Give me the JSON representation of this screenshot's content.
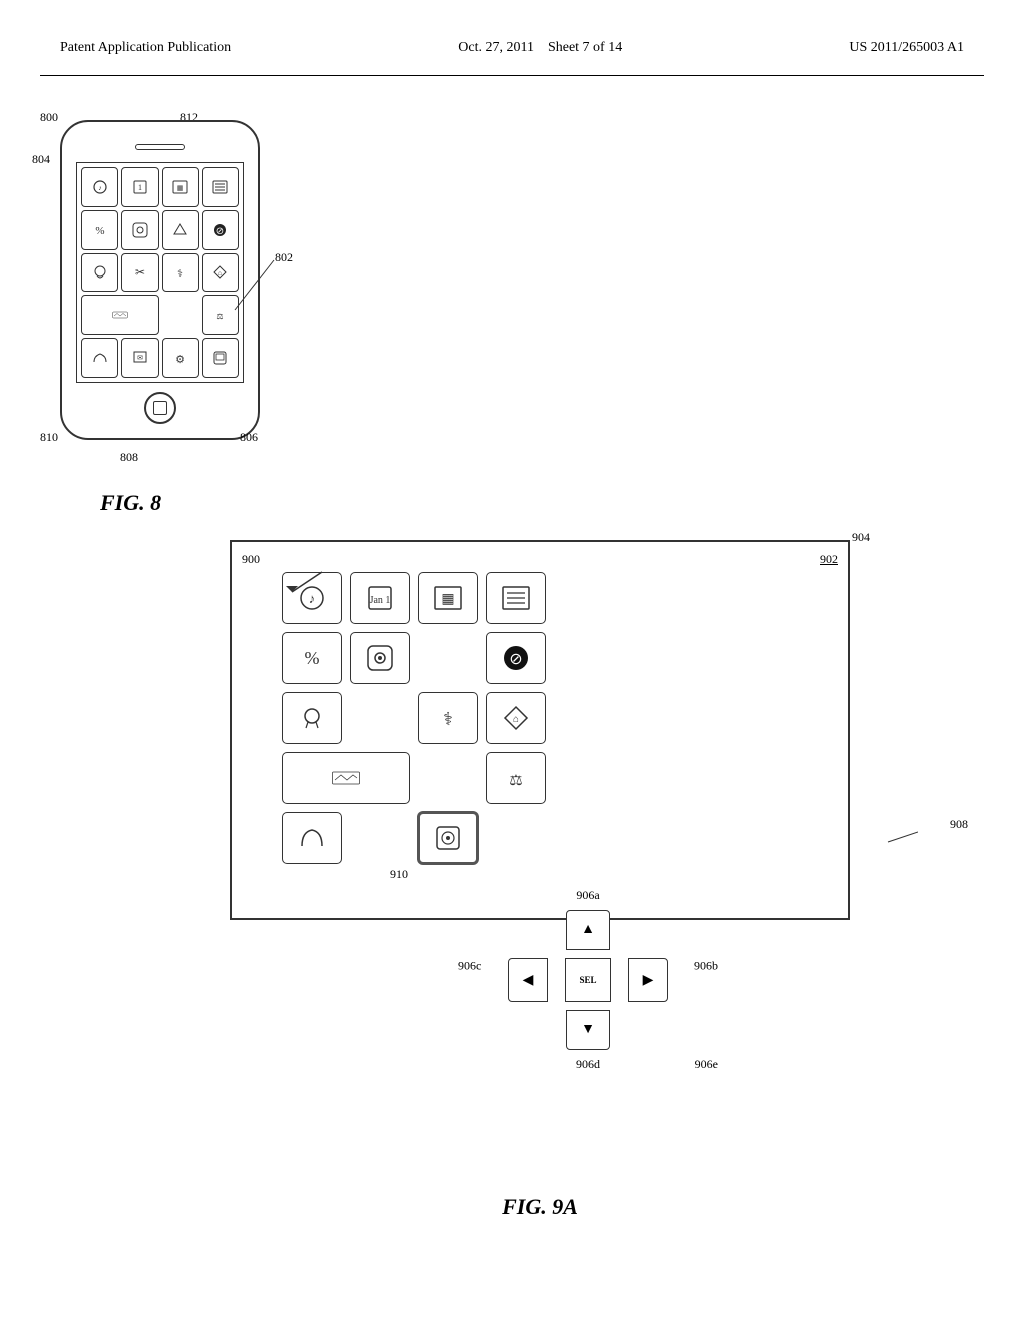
{
  "header": {
    "left": "Patent Application Publication",
    "center_date": "Oct. 27, 2011",
    "center_sheet": "Sheet 7 of 14",
    "right": "US 2011/265003 A1"
  },
  "fig8": {
    "caption": "FIG. 8",
    "labels": {
      "l800": "800",
      "l804": "804",
      "l812": "812",
      "l802": "802",
      "l806": "806",
      "l808": "808",
      "l810": "810"
    }
  },
  "fig9a": {
    "caption": "FIG. 9A",
    "labels": {
      "l900": "900",
      "l902": "902",
      "l904": "904",
      "l906a": "906a",
      "l906b": "906b",
      "l906c": "906c",
      "l906d": "906d",
      "l906e": "906e",
      "l908": "908",
      "l910": "910"
    }
  },
  "dpad": {
    "up": "▲",
    "down": "▼",
    "left": "◀",
    "right": "▶",
    "center": "SEL"
  }
}
